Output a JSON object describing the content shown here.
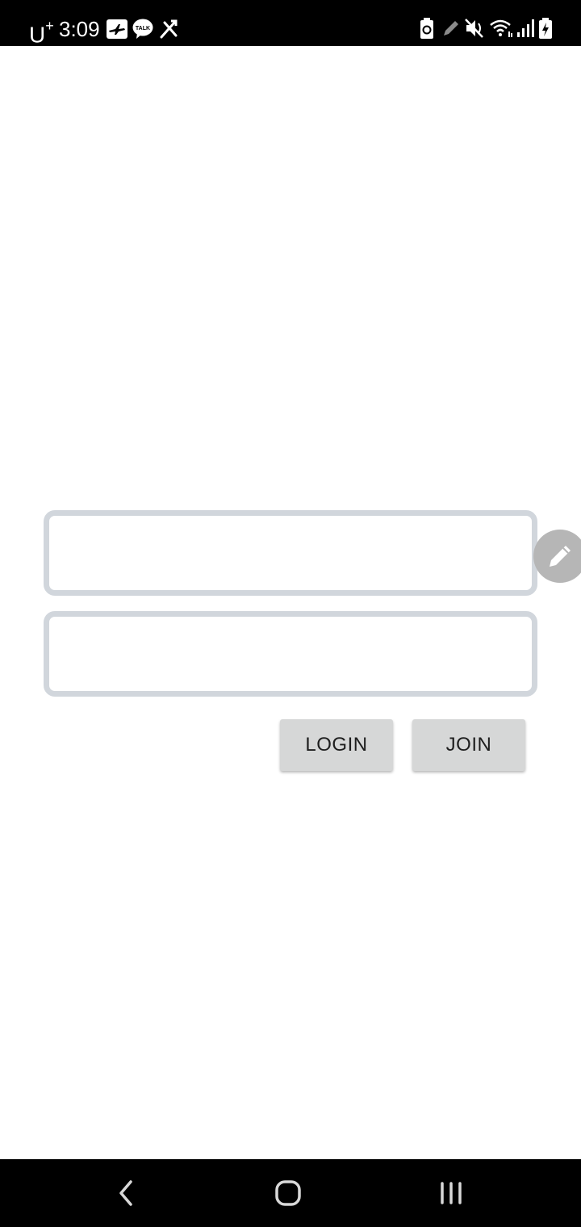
{
  "status_bar": {
    "carrier": "U",
    "carrier_suffix": "+",
    "time": "3:09",
    "notification_icons": [
      "flight-app-icon",
      "kakaotalk-icon",
      "missed-call-icon"
    ],
    "system_icons": [
      "battery-saver-icon",
      "pen-icon",
      "mute-icon",
      "wifi-icon",
      "signal-icon",
      "battery-charging-icon"
    ],
    "kakao_badge": "TALK"
  },
  "login_form": {
    "username_value": "",
    "password_value": "",
    "login_label": "LOGIN",
    "join_label": "JOIN"
  },
  "floating_button": {
    "icon": "pencil-icon"
  },
  "nav_bar": {
    "buttons": [
      "back-icon",
      "home-icon",
      "recents-icon"
    ]
  },
  "colors": {
    "status_bar": "#000000",
    "field_border": "#d1d6dc",
    "button_bg": "#d6d7d7",
    "fab_bg": "#b6b6b6"
  }
}
